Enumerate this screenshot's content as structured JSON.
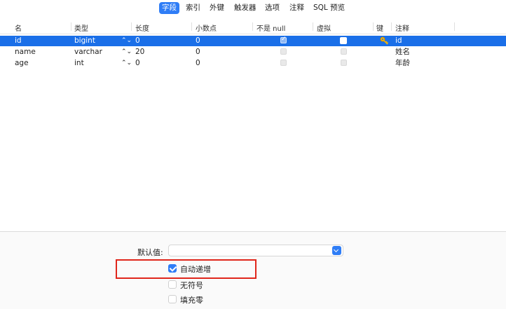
{
  "tabs": [
    "字段",
    "索引",
    "外键",
    "触发器",
    "选项",
    "注释",
    "SQL 预览"
  ],
  "active_tab": "字段",
  "columns": [
    "名",
    "类型",
    "长度",
    "小数点",
    "不是 null",
    "虚拟",
    "键",
    "注释"
  ],
  "rows": [
    {
      "name": "id",
      "type": "bigint",
      "length": "0",
      "decimals": "0",
      "not_null": true,
      "virtual": false,
      "key": true,
      "comment": "id",
      "selected": true
    },
    {
      "name": "name",
      "type": "varchar",
      "length": "20",
      "decimals": "0",
      "not_null": false,
      "virtual": false,
      "key": false,
      "comment": "姓名",
      "selected": false
    },
    {
      "name": "age",
      "type": "int",
      "length": "0",
      "decimals": "0",
      "not_null": false,
      "virtual": false,
      "key": false,
      "comment": "年龄",
      "selected": false
    }
  ],
  "stepper_glyph": "⌃⌄",
  "bottom": {
    "default_label": "默认值:",
    "default_value": "",
    "auto_increment_label": "自动递增",
    "auto_increment_checked": true,
    "unsigned_label": "无符号",
    "unsigned_checked": false,
    "zerofill_label": "填充零",
    "zerofill_checked": false
  },
  "colors": {
    "accent": "#2f7df6",
    "selection": "#1a6fe8",
    "highlight": "#e0261b"
  }
}
